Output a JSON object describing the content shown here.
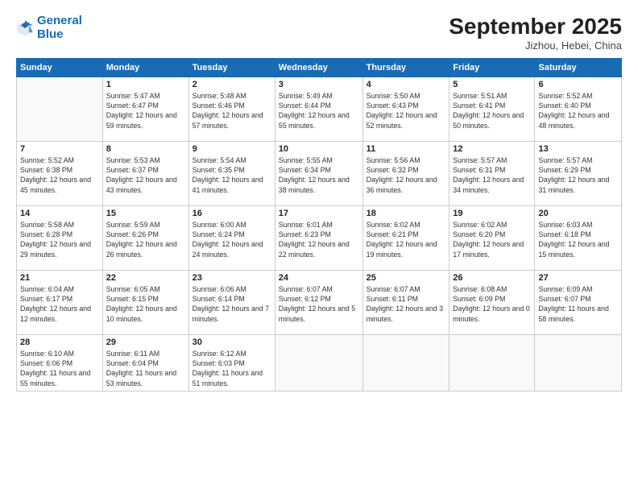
{
  "logo": {
    "line1": "General",
    "line2": "Blue"
  },
  "title": "September 2025",
  "subtitle": "Jizhou, Hebei, China",
  "days_header": [
    "Sunday",
    "Monday",
    "Tuesday",
    "Wednesday",
    "Thursday",
    "Friday",
    "Saturday"
  ],
  "weeks": [
    [
      {
        "day": "",
        "sunrise": "",
        "sunset": "",
        "daylight": ""
      },
      {
        "day": "1",
        "sunrise": "Sunrise: 5:47 AM",
        "sunset": "Sunset: 6:47 PM",
        "daylight": "Daylight: 12 hours and 59 minutes."
      },
      {
        "day": "2",
        "sunrise": "Sunrise: 5:48 AM",
        "sunset": "Sunset: 6:46 PM",
        "daylight": "Daylight: 12 hours and 57 minutes."
      },
      {
        "day": "3",
        "sunrise": "Sunrise: 5:49 AM",
        "sunset": "Sunset: 6:44 PM",
        "daylight": "Daylight: 12 hours and 55 minutes."
      },
      {
        "day": "4",
        "sunrise": "Sunrise: 5:50 AM",
        "sunset": "Sunset: 6:43 PM",
        "daylight": "Daylight: 12 hours and 52 minutes."
      },
      {
        "day": "5",
        "sunrise": "Sunrise: 5:51 AM",
        "sunset": "Sunset: 6:41 PM",
        "daylight": "Daylight: 12 hours and 50 minutes."
      },
      {
        "day": "6",
        "sunrise": "Sunrise: 5:52 AM",
        "sunset": "Sunset: 6:40 PM",
        "daylight": "Daylight: 12 hours and 48 minutes."
      }
    ],
    [
      {
        "day": "7",
        "sunrise": "Sunrise: 5:52 AM",
        "sunset": "Sunset: 6:38 PM",
        "daylight": "Daylight: 12 hours and 45 minutes."
      },
      {
        "day": "8",
        "sunrise": "Sunrise: 5:53 AM",
        "sunset": "Sunset: 6:37 PM",
        "daylight": "Daylight: 12 hours and 43 minutes."
      },
      {
        "day": "9",
        "sunrise": "Sunrise: 5:54 AM",
        "sunset": "Sunset: 6:35 PM",
        "daylight": "Daylight: 12 hours and 41 minutes."
      },
      {
        "day": "10",
        "sunrise": "Sunrise: 5:55 AM",
        "sunset": "Sunset: 6:34 PM",
        "daylight": "Daylight: 12 hours and 38 minutes."
      },
      {
        "day": "11",
        "sunrise": "Sunrise: 5:56 AM",
        "sunset": "Sunset: 6:32 PM",
        "daylight": "Daylight: 12 hours and 36 minutes."
      },
      {
        "day": "12",
        "sunrise": "Sunrise: 5:57 AM",
        "sunset": "Sunset: 6:31 PM",
        "daylight": "Daylight: 12 hours and 34 minutes."
      },
      {
        "day": "13",
        "sunrise": "Sunrise: 5:57 AM",
        "sunset": "Sunset: 6:29 PM",
        "daylight": "Daylight: 12 hours and 31 minutes."
      }
    ],
    [
      {
        "day": "14",
        "sunrise": "Sunrise: 5:58 AM",
        "sunset": "Sunset: 6:28 PM",
        "daylight": "Daylight: 12 hours and 29 minutes."
      },
      {
        "day": "15",
        "sunrise": "Sunrise: 5:59 AM",
        "sunset": "Sunset: 6:26 PM",
        "daylight": "Daylight: 12 hours and 26 minutes."
      },
      {
        "day": "16",
        "sunrise": "Sunrise: 6:00 AM",
        "sunset": "Sunset: 6:24 PM",
        "daylight": "Daylight: 12 hours and 24 minutes."
      },
      {
        "day": "17",
        "sunrise": "Sunrise: 6:01 AM",
        "sunset": "Sunset: 6:23 PM",
        "daylight": "Daylight: 12 hours and 22 minutes."
      },
      {
        "day": "18",
        "sunrise": "Sunrise: 6:02 AM",
        "sunset": "Sunset: 6:21 PM",
        "daylight": "Daylight: 12 hours and 19 minutes."
      },
      {
        "day": "19",
        "sunrise": "Sunrise: 6:02 AM",
        "sunset": "Sunset: 6:20 PM",
        "daylight": "Daylight: 12 hours and 17 minutes."
      },
      {
        "day": "20",
        "sunrise": "Sunrise: 6:03 AM",
        "sunset": "Sunset: 6:18 PM",
        "daylight": "Daylight: 12 hours and 15 minutes."
      }
    ],
    [
      {
        "day": "21",
        "sunrise": "Sunrise: 6:04 AM",
        "sunset": "Sunset: 6:17 PM",
        "daylight": "Daylight: 12 hours and 12 minutes."
      },
      {
        "day": "22",
        "sunrise": "Sunrise: 6:05 AM",
        "sunset": "Sunset: 6:15 PM",
        "daylight": "Daylight: 12 hours and 10 minutes."
      },
      {
        "day": "23",
        "sunrise": "Sunrise: 6:06 AM",
        "sunset": "Sunset: 6:14 PM",
        "daylight": "Daylight: 12 hours and 7 minutes."
      },
      {
        "day": "24",
        "sunrise": "Sunrise: 6:07 AM",
        "sunset": "Sunset: 6:12 PM",
        "daylight": "Daylight: 12 hours and 5 minutes."
      },
      {
        "day": "25",
        "sunrise": "Sunrise: 6:07 AM",
        "sunset": "Sunset: 6:11 PM",
        "daylight": "Daylight: 12 hours and 3 minutes."
      },
      {
        "day": "26",
        "sunrise": "Sunrise: 6:08 AM",
        "sunset": "Sunset: 6:09 PM",
        "daylight": "Daylight: 12 hours and 0 minutes."
      },
      {
        "day": "27",
        "sunrise": "Sunrise: 6:09 AM",
        "sunset": "Sunset: 6:07 PM",
        "daylight": "Daylight: 11 hours and 58 minutes."
      }
    ],
    [
      {
        "day": "28",
        "sunrise": "Sunrise: 6:10 AM",
        "sunset": "Sunset: 6:06 PM",
        "daylight": "Daylight: 11 hours and 55 minutes."
      },
      {
        "day": "29",
        "sunrise": "Sunrise: 6:11 AM",
        "sunset": "Sunset: 6:04 PM",
        "daylight": "Daylight: 11 hours and 53 minutes."
      },
      {
        "day": "30",
        "sunrise": "Sunrise: 6:12 AM",
        "sunset": "Sunset: 6:03 PM",
        "daylight": "Daylight: 11 hours and 51 minutes."
      },
      {
        "day": "",
        "sunrise": "",
        "sunset": "",
        "daylight": ""
      },
      {
        "day": "",
        "sunrise": "",
        "sunset": "",
        "daylight": ""
      },
      {
        "day": "",
        "sunrise": "",
        "sunset": "",
        "daylight": ""
      },
      {
        "day": "",
        "sunrise": "",
        "sunset": "",
        "daylight": ""
      }
    ]
  ]
}
